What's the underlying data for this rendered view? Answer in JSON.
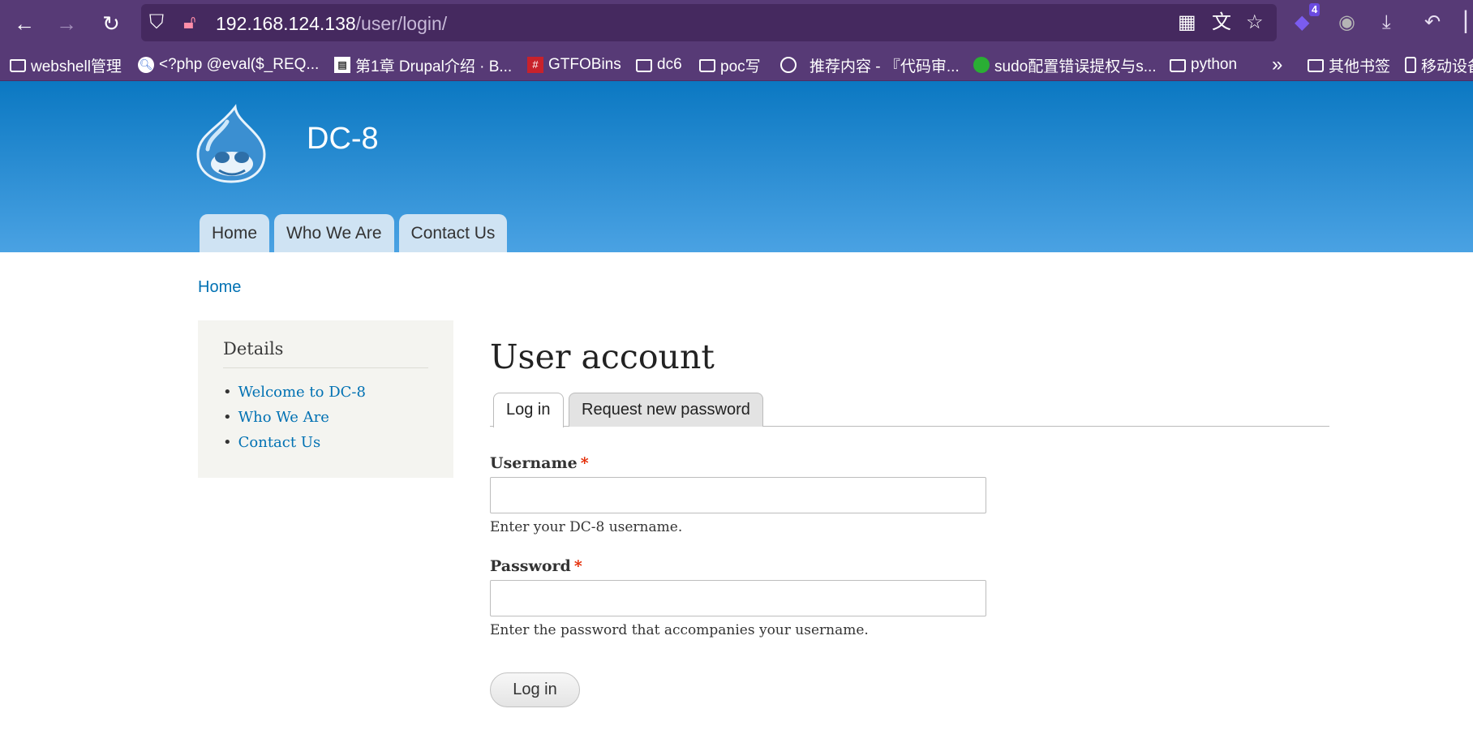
{
  "browser": {
    "url_host": "192.168.124.138",
    "url_path": "/user/login/",
    "extension_badge": "4"
  },
  "bookmarks": [
    {
      "label": "webshell管理",
      "icon": "folder-icon"
    },
    {
      "label": "<?php @eval($_REQ...",
      "icon": "search-icon"
    },
    {
      "label": "第1章 Drupal介绍 · B...",
      "icon": "book-icon"
    },
    {
      "label": "GTFOBins",
      "icon": "gtfobins-icon"
    },
    {
      "label": "dc6",
      "icon": "folder-icon"
    },
    {
      "label": "poc写",
      "icon": "folder-icon"
    },
    {
      "label": "推荐内容 - 『代码审...",
      "icon": "globe-icon"
    },
    {
      "label": "sudo配置错误提权与s...",
      "icon": "wechat-icon"
    },
    {
      "label": "python",
      "icon": "folder-icon"
    },
    {
      "label": "其他书签",
      "icon": "folder-icon"
    },
    {
      "label": "移动设备",
      "icon": "phone-icon"
    }
  ],
  "site": {
    "name": "DC-8",
    "nav": [
      "Home",
      "Who We Are",
      "Contact Us"
    ]
  },
  "breadcrumb": "Home",
  "sidebar": {
    "title": "Details",
    "links": [
      "Welcome to DC-8",
      "Who We Are",
      "Contact Us"
    ]
  },
  "main": {
    "title": "User account",
    "tabs": [
      "Log in",
      "Request new password"
    ],
    "username_label": "Username",
    "username_desc": "Enter your DC-8 username.",
    "password_label": "Password",
    "password_desc": "Enter the password that accompanies your username.",
    "required_mark": "*",
    "submit_label": "Log in"
  }
}
